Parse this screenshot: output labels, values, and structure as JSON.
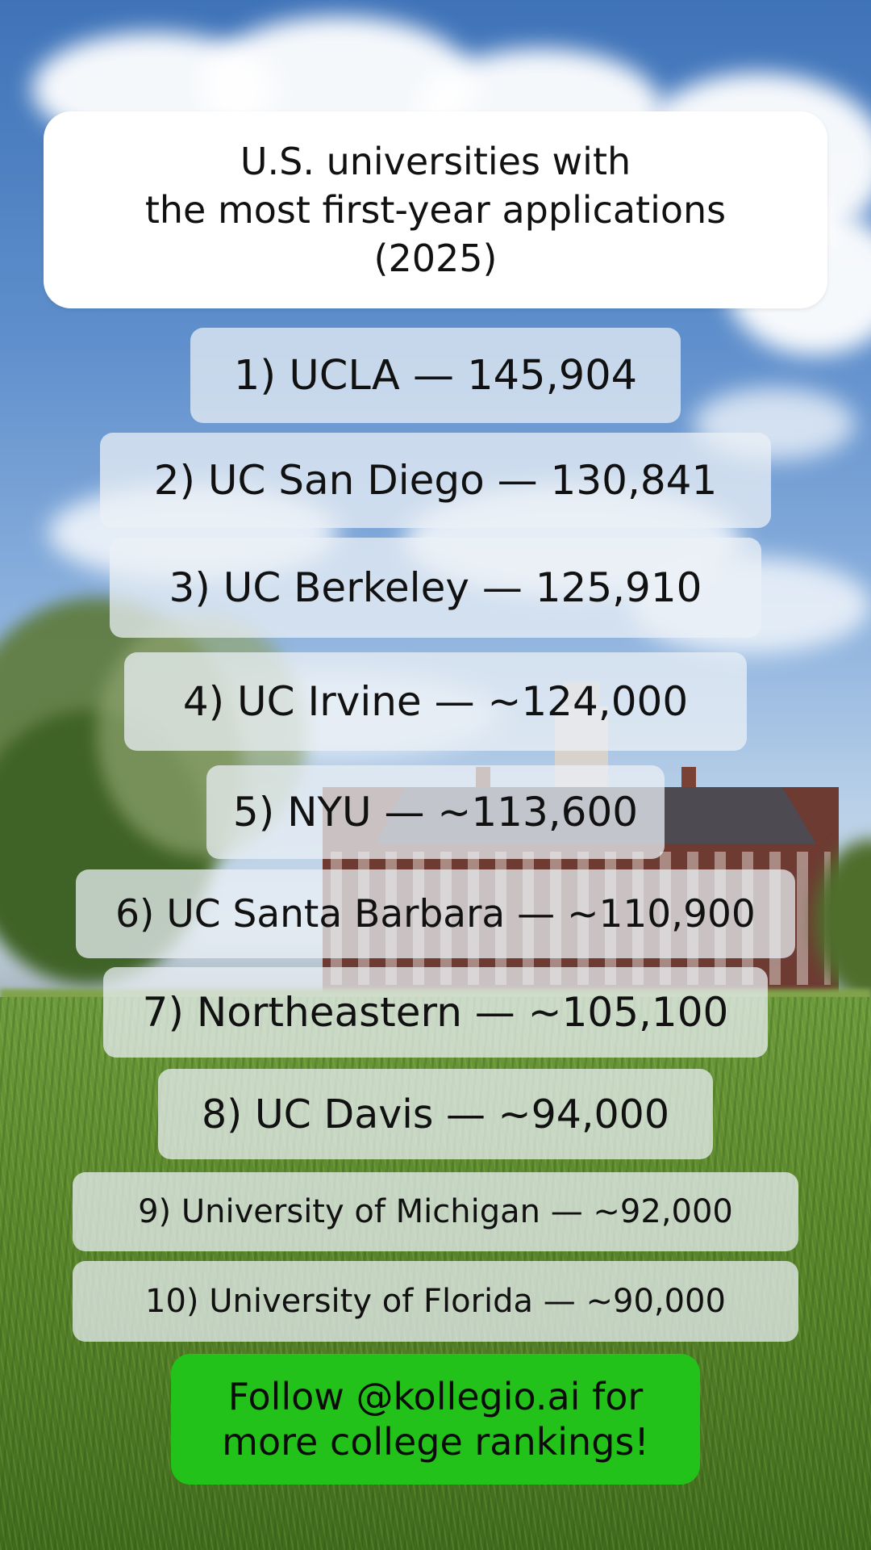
{
  "title": {
    "line1": "U.S. universities with",
    "line2": "the most first-year applications",
    "line3": "(2025)"
  },
  "rankings": [
    {
      "label": "1) UCLA — 145,904"
    },
    {
      "label": "2) UC San Diego — 130,841"
    },
    {
      "label": "3) UC Berkeley — 125,910"
    },
    {
      "label": "4) UC Irvine — ~124,000"
    },
    {
      "label": "5) NYU — ~113,600"
    },
    {
      "label": "6) UC Santa Barbara — ~110,900"
    },
    {
      "label": "7) Northeastern — ~105,100"
    },
    {
      "label": "8) UC Davis — ~94,000"
    },
    {
      "label": "9) University of Michigan — ~92,000"
    },
    {
      "label": "10) University of Florida — ~90,000"
    }
  ],
  "cta": {
    "line1": "Follow @kollegio.ai for",
    "line2": "more college rankings!"
  },
  "colors": {
    "cta_green": "#22c21a",
    "title_card": "#ffffff",
    "pill_fill": "rgba(235,240,245,0.74)"
  }
}
